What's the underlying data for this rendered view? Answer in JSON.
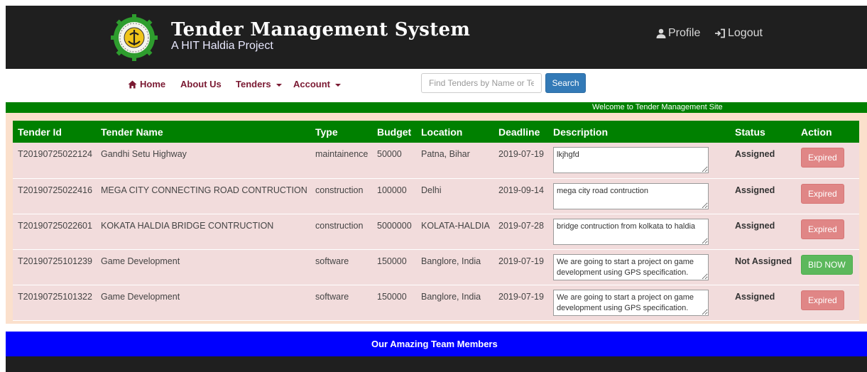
{
  "header": {
    "title": "Tender Management System",
    "subtitle": "A HIT Haldia Project",
    "profile_label": "Profile",
    "logout_label": "Logout"
  },
  "nav": {
    "home": "Home",
    "about": "About Us",
    "tenders": "Tenders",
    "account": "Account",
    "search_placeholder": "Find Tenders by Name or Ten",
    "search_button": "Search"
  },
  "welcome_text": "Welcome to Tender Management Site",
  "table": {
    "headers": [
      "Tender Id",
      "Tender Name",
      "Type",
      "Budget",
      "Location",
      "Deadline",
      "Description",
      "Status",
      "Action"
    ],
    "rows": [
      {
        "id": "T20190725022124",
        "name": "Gandhi Setu Highway",
        "type": "maintainence",
        "budget": "50000",
        "location": "Patna, Bihar",
        "deadline": "2019-07-19",
        "description": "lkjhgfd",
        "status": "Assigned",
        "action": "Expired"
      },
      {
        "id": "T20190725022416",
        "name": "MEGA CITY CONNECTING ROAD CONTRUCTION",
        "type": "construction",
        "budget": "100000",
        "location": "Delhi",
        "deadline": "2019-09-14",
        "description": "mega city road contruction",
        "status": "Assigned",
        "action": "Expired"
      },
      {
        "id": "T20190725022601",
        "name": "KOKATA HALDIA BRIDGE CONTRUCTION",
        "type": "construction",
        "budget": "5000000",
        "location": "KOLATA-HALDIA",
        "deadline": "2019-07-28",
        "description": "bridge contruction from kolkata to haldia",
        "status": "Assigned",
        "action": "Expired"
      },
      {
        "id": "T20190725101239",
        "name": "Game Development",
        "type": "software",
        "budget": "150000",
        "location": "Banglore, India",
        "deadline": "2019-07-19",
        "description": "We are going to start a project on game development using GPS specification.",
        "status": "Not Assigned",
        "action": "BID NOW"
      },
      {
        "id": "T20190725101322",
        "name": "Game Development",
        "type": "software",
        "budget": "150000",
        "location": "Banglore, India",
        "deadline": "2019-07-19",
        "description": "We are going to start a project on game development using GPS specification.",
        "status": "Assigned",
        "action": "Expired"
      }
    ]
  },
  "team_title": "Our Amazing Team Members",
  "colors": {
    "header_bg": "#1f1f1f",
    "nav_text": "#7a1932",
    "table_header": "#008000",
    "team_bar": "#0000ff",
    "expired": "#e08686",
    "bid_now": "#5cb85c"
  },
  "icons": {
    "logo": "institute-gear-emblem-icon",
    "profile": "user-icon",
    "logout": "logout-icon",
    "home": "home-icon",
    "dropdown": "caret-down-icon",
    "textarea_resize": "resize-grip-icon"
  }
}
